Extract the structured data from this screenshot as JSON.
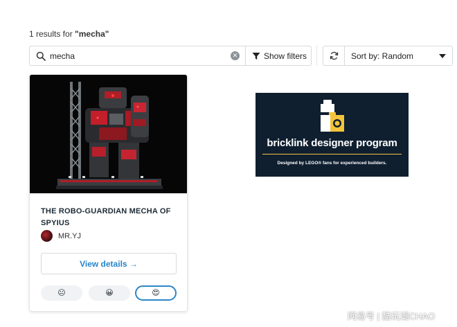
{
  "results": {
    "count_prefix": "1 results for ",
    "query_quoted": "\"mecha\""
  },
  "search": {
    "value": "mecha",
    "clear_icon": "clear-icon",
    "search_icon": "search-icon"
  },
  "filters": {
    "label": "Show filters",
    "icon": "funnel-icon"
  },
  "sort": {
    "label": "Sort by: Random",
    "refresh_icon": "refresh-icon"
  },
  "card": {
    "title_line1": "THE ROBO-GUARDIAN MECHA OF",
    "title_line2": "SPYIUS",
    "author": "MR.YJ",
    "view_label": "View details →",
    "reactions": [
      "😐",
      "😀",
      "😍"
    ]
  },
  "banner": {
    "wordmark": "bricklink designer program",
    "tagline": "Designed by LEGO® fans for experienced builders."
  },
  "watermark": "网易号 | 酷玩潮CHAO",
  "colors": {
    "accent": "#2785c9",
    "banner_bg": "#0f1f30",
    "banner_rule": "#f3c43b"
  }
}
